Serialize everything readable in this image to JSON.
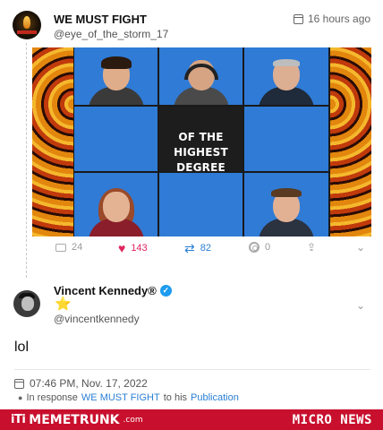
{
  "original_post": {
    "author_name": "WE MUST FIGHT",
    "author_handle": "@eye_of_the_storm_17",
    "time_label": "16 hours ago",
    "media_caption": "OF THE HIGHEST DEGREE",
    "stats": {
      "comments": "24",
      "likes": "143",
      "retweets": "82",
      "views": "0"
    }
  },
  "reply": {
    "author_name": "Vincent Kennedy®",
    "author_handle": "@vincentkennedy",
    "badge_emoji": "⭐",
    "text": "lol",
    "date": "07:46 PM, Nov. 17, 2022",
    "response_prefix": "In response",
    "response_to": "WE MUST FIGHT",
    "response_mid": "to his",
    "response_link": "Publication"
  },
  "footer": {
    "logo": "iTi",
    "site_name": "MEMETRUNK",
    "site_tld": ".com",
    "section": "MICRO NEWS"
  },
  "colors": {
    "like": "#e0245e",
    "retweet": "#2a7fd4",
    "footer_bg": "#c8102e",
    "tile_blue": "#2f7bd6"
  }
}
